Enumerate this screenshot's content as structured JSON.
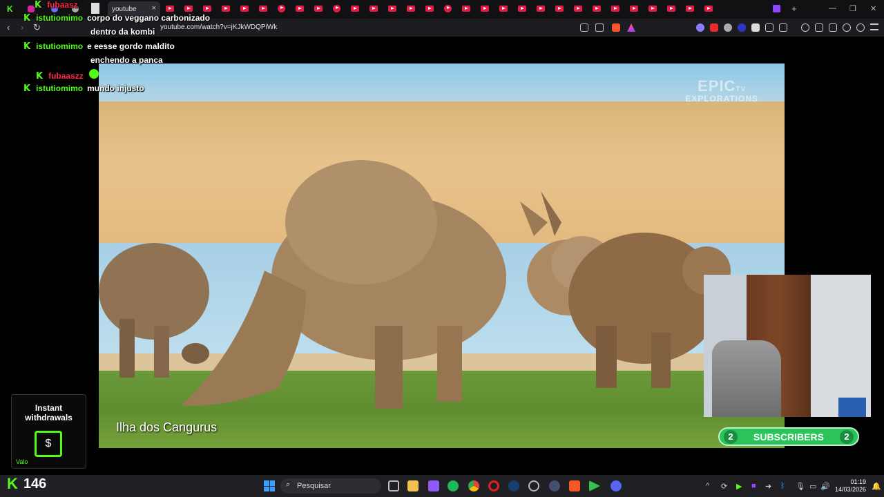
{
  "browser": {
    "active_tab_label": "youtube",
    "url": "youtube.com/watch?v=jKJkWDQPiWk",
    "tab_count_youtube": 30
  },
  "chat": [
    {
      "user": "fubaasz",
      "user_color": "red",
      "message": ""
    },
    {
      "user": "istutiomimo",
      "user_color": "green",
      "message": "corpo do veggano carbonizado"
    },
    {
      "user": "",
      "user_color": "green",
      "message": "dentro da kombi"
    },
    {
      "user": "istutiomimo",
      "user_color": "green",
      "message": "e eesse gordo maldito"
    },
    {
      "user": "",
      "user_color": "green",
      "message": "enchendo a panca"
    },
    {
      "user": "fubaaszz",
      "user_color": "red",
      "message": ""
    },
    {
      "user": "istutiomimo",
      "user_color": "green",
      "message": "mundo injusto"
    }
  ],
  "video": {
    "watermark_big": "EPIC",
    "watermark_tv": "TV",
    "watermark_small": "EXPLORATIONS",
    "caption": "Ilha dos Cangurus"
  },
  "subscribers": {
    "left_count": "2",
    "label": "SUBSCRIBERS",
    "right_count": "2"
  },
  "ad": {
    "title_line1": "Instant",
    "title_line2": "withdrawals",
    "footer": "Valo"
  },
  "viewers": {
    "count": "146"
  },
  "taskbar": {
    "search_placeholder": "Pesquisar",
    "time": "01:19",
    "date": "14/03/2026"
  },
  "colors": {
    "kick_green": "#53fc18",
    "red_user": "#ff2a4a",
    "subs_green": "#2bc45a"
  }
}
